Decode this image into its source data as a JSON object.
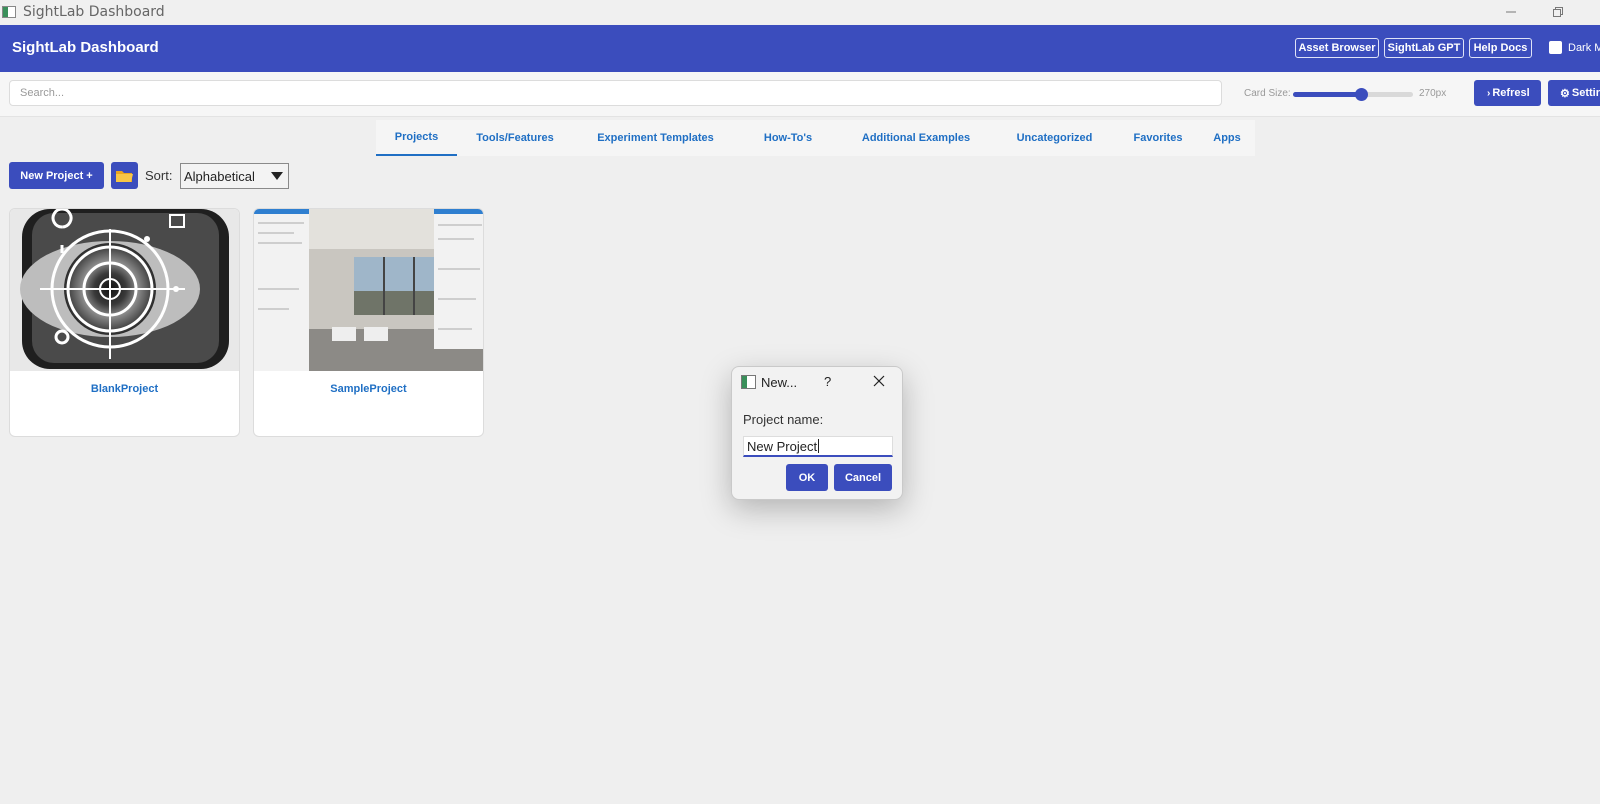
{
  "window": {
    "title": "SightLab Dashboard",
    "minimize_icon": "minimize-icon",
    "restore_icon": "restore-icon"
  },
  "header": {
    "title": "SightLab Dashboard",
    "buttons": [
      {
        "label": "Asset Browser"
      },
      {
        "label": "SightLab GPT"
      },
      {
        "label": "Help Docs"
      }
    ],
    "dark_mode_label": "Dark M",
    "dark_mode_checked": false
  },
  "toolbar": {
    "search_placeholder": "Search...",
    "card_size_label": "Card Size:",
    "card_size_value": "270px",
    "card_size_fraction": 0.57,
    "refresh_label": "Refresl",
    "refresh_icon": "refresh-icon",
    "settings_label": "Settir",
    "settings_icon": "gear-icon"
  },
  "tabs": [
    {
      "label": "Projects",
      "active": true
    },
    {
      "label": "Tools/Features"
    },
    {
      "label": "Experiment Templates"
    },
    {
      "label": "How-To's"
    },
    {
      "label": "Additional Examples"
    },
    {
      "label": "Uncategorized"
    },
    {
      "label": "Favorites"
    },
    {
      "label": "Apps"
    }
  ],
  "actions": {
    "new_project_label": "New Project +",
    "folder_icon": "folder-icon",
    "sort_label": "Sort:",
    "sort_value": "Alphabetical"
  },
  "cards": [
    {
      "name": "BlankProject",
      "thumbnail": "eye-target-icon"
    },
    {
      "name": "SampleProject",
      "thumbnail": "room-screenshot"
    }
  ],
  "dialog": {
    "title": "New...",
    "help": "?",
    "label": "Project name:",
    "input_value": "New Project",
    "ok_label": "OK",
    "cancel_label": "Cancel"
  },
  "colors": {
    "accent": "#3b4dbd",
    "link": "#1f6fc4",
    "background": "#efefef"
  }
}
